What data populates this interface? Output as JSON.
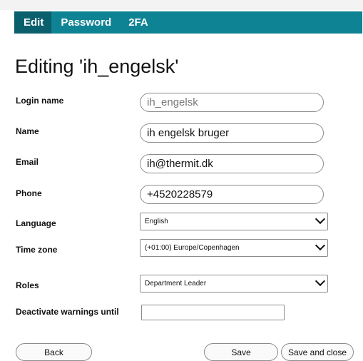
{
  "tabs": [
    {
      "label": "Edit",
      "active": true
    },
    {
      "label": "Password",
      "active": false
    },
    {
      "label": "2FA",
      "active": false
    }
  ],
  "heading": "Editing 'ih_engelsk'",
  "form": {
    "login_name": {
      "label": "Login name",
      "value": "ih_engelsk"
    },
    "name": {
      "label": "Name",
      "value": "ih engelsk bruger"
    },
    "email": {
      "label": "Email",
      "value": "ih@thermit.dk"
    },
    "phone": {
      "label": "Phone",
      "value": "+4520228579"
    },
    "language": {
      "label": "Language",
      "selected": "English"
    },
    "time_zone": {
      "label": "Time zone",
      "selected": "(+01:00) Europe/Copenhagen"
    },
    "roles": {
      "label": "Roles",
      "selected": "Department Leader"
    },
    "deactivate_warnings": {
      "label": "Deactivate warnings until",
      "value": ""
    }
  },
  "buttons": {
    "back": "Back",
    "save": "Save",
    "save_and_close": "Save and close"
  },
  "colors": {
    "tabbar": "#0e8394",
    "tab_active": "#0a5f6d"
  }
}
